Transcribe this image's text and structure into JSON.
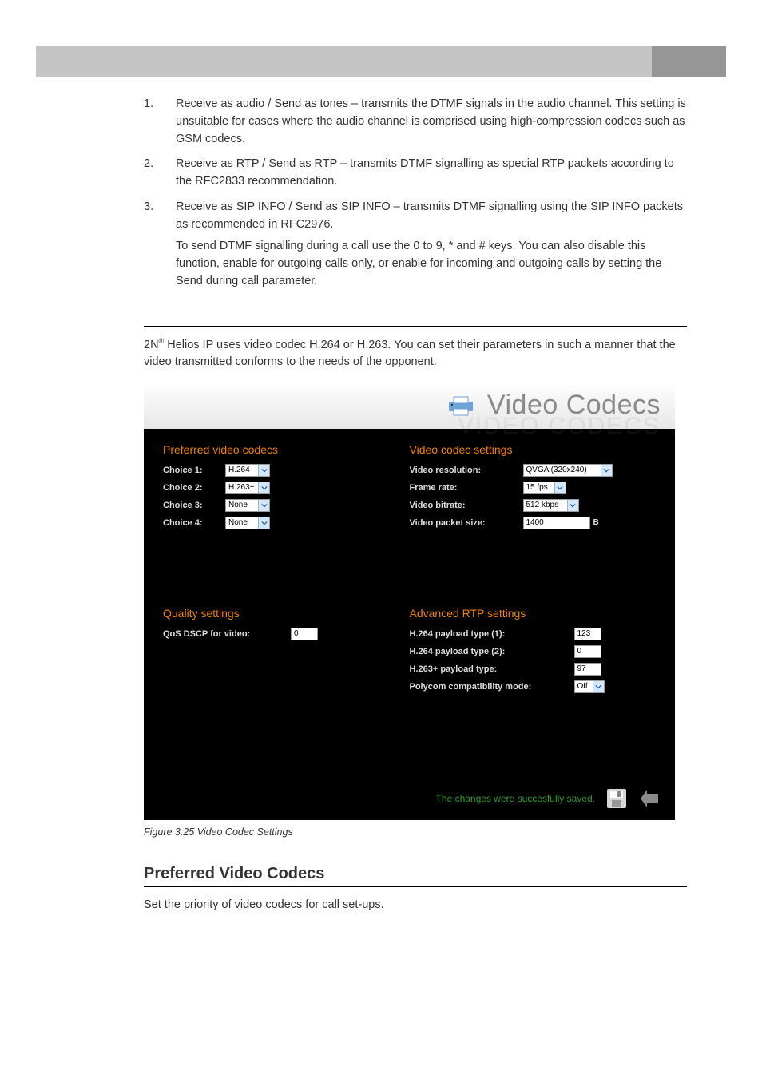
{
  "list": {
    "i1_num": "1.",
    "i1": "Receive as audio / Send as tones – transmits the DTMF signals in the audio channel.  This setting is unsuitable for cases where the audio channel is comprised using high-compression codecs such as GSM codecs.",
    "i2_num": "2.",
    "i2": "Receive as RTP / Send as RTP – transmits DTMF signalling as special RTP packets according to the RFC2833 recommendation.",
    "i3_num": "3.",
    "i3": "Receive as SIP INFO / Send as SIP INFO – transmits DTMF signalling using the SIP INFO packets as recommended in RFC2976.",
    "i3b": "To send DTMF signalling during a call use the 0 to 9, * and # keys. You can also disable this function, enable for outgoing calls only, or enable for incoming and outgoing calls by setting the Send during call parameter."
  },
  "intro": {
    "prefix": "2N",
    "sup": "®",
    "rest": " Helios IP uses video codec H.264 or H.263. You can set their parameters in such a manner that the video transmitted conforms to the needs of the opponent."
  },
  "panel": {
    "title": "Video Codecs",
    "ghost": "VIDEO CODECS",
    "preferred": {
      "heading": "Preferred video codecs",
      "rows": [
        {
          "label": "Choice 1:",
          "value": "H.264"
        },
        {
          "label": "Choice 2:",
          "value": "H.263+"
        },
        {
          "label": "Choice 3:",
          "value": "None"
        },
        {
          "label": "Choice 4:",
          "value": "None"
        }
      ]
    },
    "settings": {
      "heading": "Video codec settings",
      "resolution": {
        "label": "Video resolution:",
        "value": "QVGA (320x240)"
      },
      "framerate": {
        "label": "Frame rate:",
        "value": "15 fps"
      },
      "bitrate": {
        "label": "Video bitrate:",
        "value": "512 kbps"
      },
      "packet": {
        "label": "Video packet size:",
        "value": "1400",
        "unit": "B"
      }
    },
    "quality": {
      "heading": "Quality settings",
      "dscp": {
        "label": "QoS DSCP for video:",
        "value": "0"
      }
    },
    "advanced": {
      "heading": "Advanced RTP settings",
      "p1": {
        "label": "H.264 payload type (1):",
        "value": "123"
      },
      "p2": {
        "label": "H.264 payload type (2):",
        "value": "0"
      },
      "p3": {
        "label": "H.263+ payload type:",
        "value": "97"
      },
      "pc": {
        "label": "Polycom compatibility mode:",
        "value": "Off"
      }
    },
    "saved": "The changes were succesfully saved."
  },
  "figure": "Figure 3.25    Video Codec Settings",
  "h2": "Preferred Video Codecs",
  "after": "Set the priority of video codecs for call set-ups."
}
